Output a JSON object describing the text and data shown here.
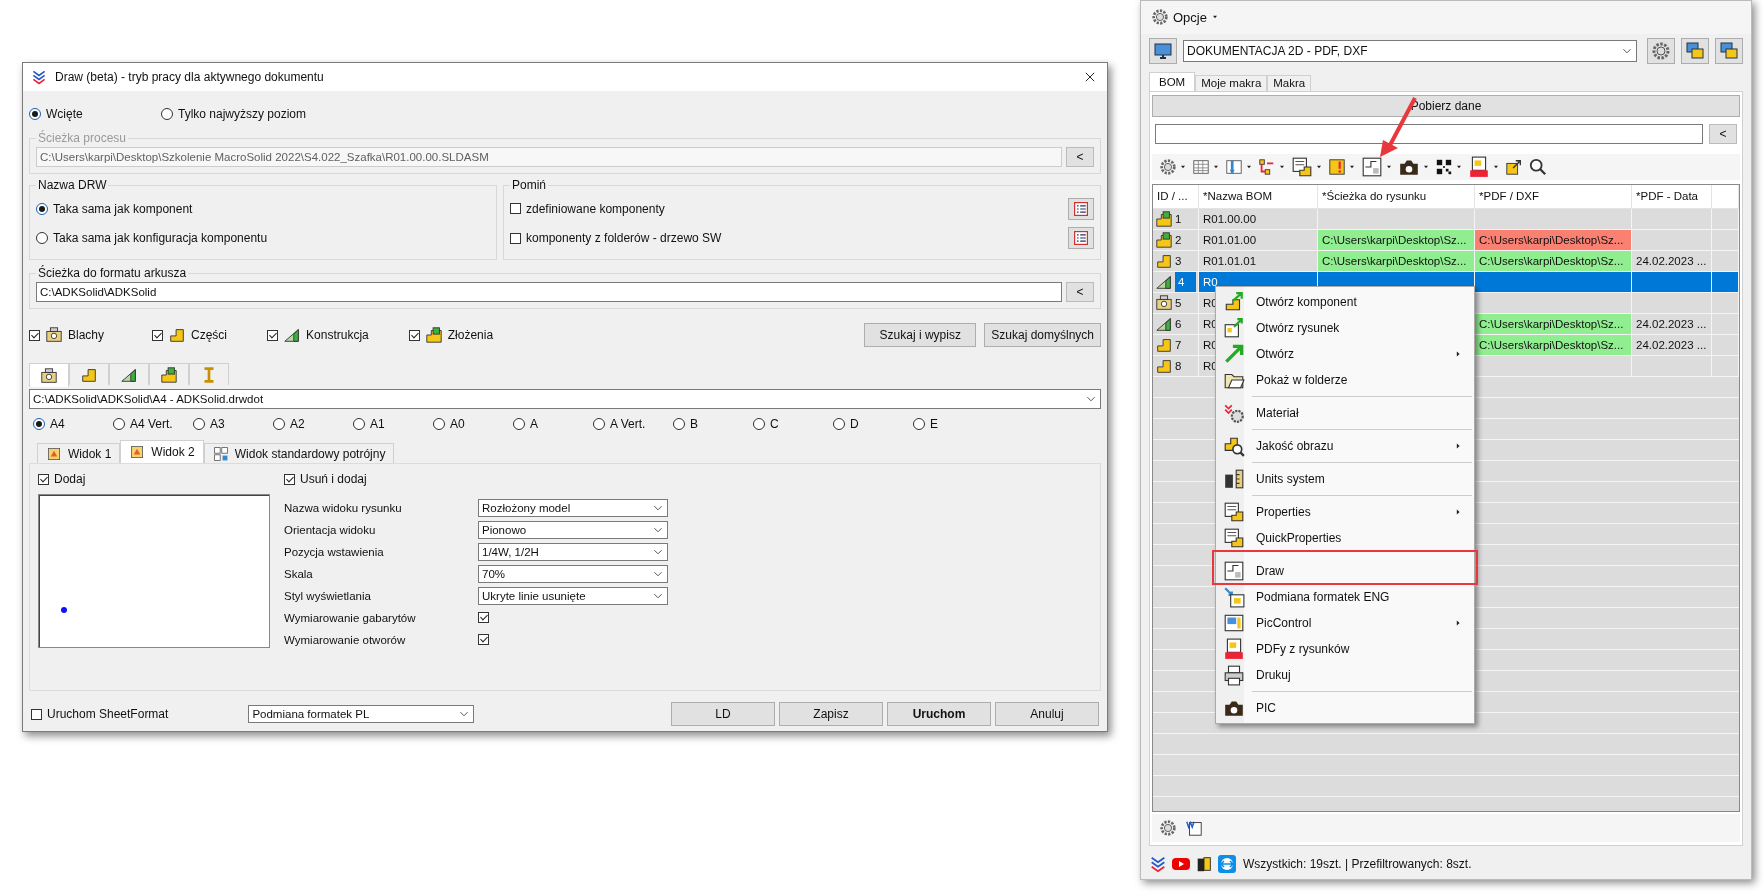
{
  "dialog": {
    "title": "Draw (beta) - tryb pracy dla aktywnego dokumentu",
    "scope_options": [
      {
        "label": "Wcięte",
        "selected": true
      },
      {
        "label": "Tylko najwyższy poziom",
        "selected": false
      }
    ],
    "process_path": {
      "label": "Ścieżka procesu",
      "value": "C:\\Users\\karpi\\Desktop\\Szkolenie MacroSolid 2022\\S4.022_Szafka\\R01.00.00.SLDASM",
      "button": "<",
      "disabled": true
    },
    "drw_name": {
      "label": "Nazwa DRW",
      "options": [
        {
          "label": "Taka sama jak komponent",
          "selected": true
        },
        {
          "label": "Taka sama jak konfiguracja komponentu",
          "selected": false
        }
      ]
    },
    "skip": {
      "label": "Pomiń",
      "options": [
        {
          "label": "zdefiniowane komponenty",
          "checked": false
        },
        {
          "label": "komponenty z folderów - drzewo SW",
          "checked": false
        }
      ]
    },
    "sheet_format_path": {
      "label": "Ścieżka do formatu arkusza",
      "value": "C:\\ADKSolid\\ADKSolid",
      "button": "<"
    },
    "component_types": [
      {
        "label": "Blachy",
        "checked": true,
        "kind": "sheetmetal"
      },
      {
        "label": "Części",
        "checked": true,
        "kind": "part"
      },
      {
        "label": "Konstrukcja",
        "checked": true,
        "kind": "weldment"
      },
      {
        "label": "Złożenia",
        "checked": true,
        "kind": "assembly"
      }
    ],
    "search_buttons": [
      "Szukaj i wypisz",
      "Szukaj domyślnych"
    ],
    "type_tabs": [
      {
        "kind": "sheetmetal",
        "selected": true
      },
      {
        "kind": "part",
        "selected": false
      },
      {
        "kind": "weldment",
        "selected": false
      },
      {
        "kind": "assembly",
        "selected": false
      },
      {
        "kind": "beam",
        "selected": false
      }
    ],
    "template": "C:\\ADKSolid\\ADKSolid\\A4 - ADKSolid.drwdot",
    "sizes": [
      {
        "label": "A4",
        "selected": true
      },
      {
        "label": "A4 Vert.",
        "selected": false
      },
      {
        "label": "A3",
        "selected": false
      },
      {
        "label": "A2",
        "selected": false
      },
      {
        "label": "A1",
        "selected": false
      },
      {
        "label": "A0",
        "selected": false
      },
      {
        "label": "A",
        "selected": false
      },
      {
        "label": "A Vert.",
        "selected": false
      },
      {
        "label": "B",
        "selected": false
      },
      {
        "label": "C",
        "selected": false
      },
      {
        "label": "D",
        "selected": false
      },
      {
        "label": "E",
        "selected": false
      }
    ],
    "view_tabs": [
      {
        "label": "Widok 1",
        "selected": false,
        "kind": "view"
      },
      {
        "label": "Widok 2",
        "selected": true,
        "kind": "view"
      },
      {
        "label": "Widok standardowy potrójny",
        "selected": false,
        "kind": "triple"
      }
    ],
    "view": {
      "add": {
        "label": "Dodaj",
        "checked": true
      },
      "remove_add": {
        "label": "Usuń i dodaj",
        "checked": true
      },
      "fields": [
        {
          "label": "Nazwa widoku rysunku",
          "kind": "select",
          "value": "Rozłożony model"
        },
        {
          "label": "Orientacja widoku",
          "kind": "select",
          "value": "Pionowo"
        },
        {
          "label": "Pozycja wstawienia",
          "kind": "select",
          "value": "1/4W, 1/2H"
        },
        {
          "label": "Skala",
          "kind": "select",
          "value": "70%"
        },
        {
          "label": "Styl wyświetlania",
          "kind": "select",
          "value": "Ukryte linie usunięte"
        },
        {
          "label": "Wymiarowanie gabarytów",
          "kind": "checkbox",
          "checked": true
        },
        {
          "label": "Wymiarowanie otworów",
          "kind": "checkbox",
          "checked": true
        }
      ]
    },
    "footer": {
      "sheetformat": {
        "label": "Uruchom SheetFormat",
        "checked": false
      },
      "macro": "Podmiana formatek PL",
      "buttons": [
        {
          "label": "LD",
          "primary": false
        },
        {
          "label": "Zapisz",
          "primary": false
        },
        {
          "label": "Uruchom",
          "primary": true
        },
        {
          "label": "Anuluj",
          "primary": false
        }
      ]
    }
  },
  "panel": {
    "menu": "Opcje",
    "profile": "DOKUMENTACJA 2D - PDF, DXF",
    "tabs": [
      {
        "label": "BOM",
        "selected": true
      },
      {
        "label": "Moje makra",
        "selected": false
      },
      {
        "label": "Makra",
        "selected": false
      }
    ],
    "fetch_button": "Pobierz dane",
    "search_button": "<",
    "columns": [
      "ID / ...",
      "*Nazwa BOM",
      "*Ścieżka do rysunku",
      "*PDF / DXF",
      "*PDF - Data"
    ],
    "rows": [
      {
        "id": "1",
        "kind": "assembly",
        "selected": false,
        "name": "R01.00.00"
      },
      {
        "id": "2",
        "kind": "assembly",
        "selected": false,
        "name": "R01.01.00",
        "drawing": {
          "text": "C:\\Users\\karpi\\Desktop\\Sz...",
          "color": "#90ee90"
        },
        "pdf": {
          "text": "C:\\Users\\karpi\\Desktop\\Sz...",
          "color": "#fa8072"
        }
      },
      {
        "id": "3",
        "kind": "part",
        "selected": false,
        "name": "R01.01.01",
        "drawing": {
          "text": "C:\\Users\\karpi\\Desktop\\Sz...",
          "color": "#90ee90"
        },
        "pdf": {
          "text": "C:\\Users\\karpi\\Desktop\\Sz...",
          "color": "#90ee90"
        },
        "date": "24.02.2023 ..."
      },
      {
        "id": "4",
        "kind": "weldment",
        "selected": true,
        "name": "R0"
      },
      {
        "id": "5",
        "kind": "sheetmetal",
        "selected": false,
        "name": "R0"
      },
      {
        "id": "6",
        "kind": "weldment",
        "selected": false,
        "name": "R0",
        "pdf": {
          "text": "C:\\Users\\karpi\\Desktop\\Sz...",
          "color": "#90ee90"
        },
        "date": "24.02.2023 ..."
      },
      {
        "id": "7",
        "kind": "part",
        "selected": false,
        "name": "R0",
        "pdf": {
          "text": "C:\\Users\\karpi\\Desktop\\Sz...",
          "color": "#90ee90"
        },
        "date": "24.02.2023 ..."
      },
      {
        "id": "8",
        "kind": "part",
        "selected": false,
        "name": "R0"
      }
    ],
    "context_menu": [
      {
        "label": "Otwórz komponent",
        "separator_before": false,
        "submenu": false,
        "highlighted": false
      },
      {
        "label": "Otwórz rysunek",
        "separator_before": false,
        "submenu": false,
        "highlighted": false
      },
      {
        "label": "Otwórz",
        "separator_before": false,
        "submenu": true,
        "highlighted": false
      },
      {
        "label": "Pokaż w folderze",
        "separator_before": false,
        "submenu": false,
        "highlighted": false
      },
      {
        "label": "Materiał",
        "separator_before": true,
        "submenu": false,
        "highlighted": false
      },
      {
        "label": "Jakość obrazu",
        "separator_before": true,
        "submenu": true,
        "highlighted": false
      },
      {
        "label": "Units system",
        "separator_before": true,
        "submenu": false,
        "highlighted": false
      },
      {
        "label": "Properties",
        "separator_before": true,
        "submenu": true,
        "highlighted": false
      },
      {
        "label": "QuickProperties",
        "separator_before": false,
        "submenu": false,
        "highlighted": false
      },
      {
        "label": "Draw",
        "separator_before": true,
        "submenu": false,
        "highlighted": true
      },
      {
        "label": "Podmiana formatek ENG",
        "separator_before": false,
        "submenu": false,
        "highlighted": false
      },
      {
        "label": "PicControl",
        "separator_before": false,
        "submenu": true,
        "highlighted": false
      },
      {
        "label": "PDFy z rysunków",
        "separator_before": false,
        "submenu": false,
        "highlighted": false
      },
      {
        "label": "Drukuj",
        "separator_before": false,
        "submenu": false,
        "highlighted": false
      },
      {
        "label": "PIC",
        "separator_before": true,
        "submenu": false,
        "highlighted": false
      }
    ],
    "status": "Wszystkich: 19szt. | Przefiltrowanych: 8szt."
  }
}
